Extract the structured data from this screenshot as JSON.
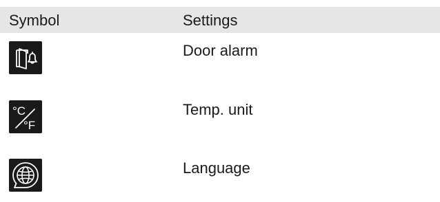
{
  "table": {
    "headers": {
      "symbol": "Symbol",
      "settings": "Settings"
    },
    "rows": [
      {
        "icon": "door-alarm-icon",
        "label": "Door alarm"
      },
      {
        "icon": "temperature-unit-icon",
        "label": "Temp. unit",
        "icon_text": {
          "celsius": "°C",
          "fahrenheit": "°F"
        }
      },
      {
        "icon": "language-globe-icon",
        "label": "Language"
      }
    ]
  },
  "colors": {
    "header_background": "#e6e6e6",
    "icon_tile": "#1a1a1a",
    "icon_glyph": "#ffffff",
    "text": "#1a1a1a"
  }
}
